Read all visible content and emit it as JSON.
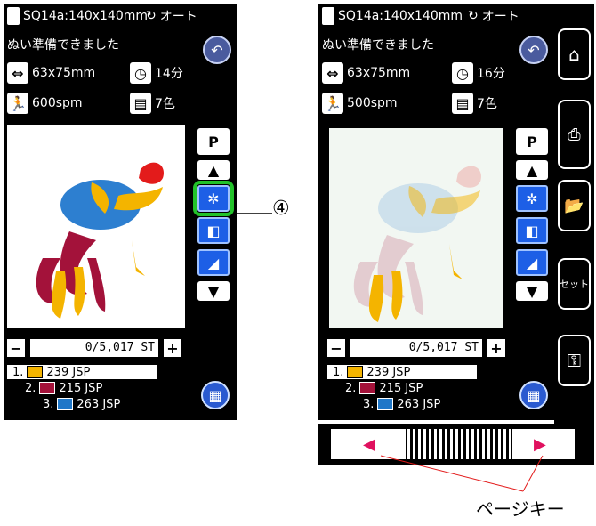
{
  "screen_left": {
    "header": {
      "title": "SQ14a:140x140mm",
      "mode": "オート"
    },
    "status": "ぬい準備できました",
    "size": "63x75mm",
    "time": "14分",
    "speed": "600spm",
    "colors_count": "7色",
    "stitch_counter": "0/5,017 ST",
    "color_list": [
      {
        "index": "1.",
        "code": "239 JSP",
        "color": "#f4b400"
      },
      {
        "index": "2.",
        "code": "215 JSP",
        "color": "#a3123a"
      },
      {
        "index": "3.",
        "code": "263 JSP",
        "color": "#1f77c8"
      }
    ]
  },
  "screen_right": {
    "header": {
      "title": "SQ14a:140x140mm",
      "mode": "オート"
    },
    "status": "ぬい準備できました",
    "size": "63x75mm",
    "time": "16分",
    "speed": "500spm",
    "colors_count": "7色",
    "stitch_counter": "0/5,017 ST",
    "color_list": [
      {
        "index": "1.",
        "code": "239 JSP",
        "color": "#f4b400"
      },
      {
        "index": "2.",
        "code": "215 JSP",
        "color": "#a3123a"
      },
      {
        "index": "3.",
        "code": "263 JSP",
        "color": "#1f77c8"
      }
    ]
  },
  "right_panel": {
    "set_label": "セット"
  },
  "callout": {
    "number": "④",
    "page_key_label": "ページキー"
  },
  "colors": {
    "accent": "#1d5fe6",
    "highlight": "#22c22a"
  }
}
